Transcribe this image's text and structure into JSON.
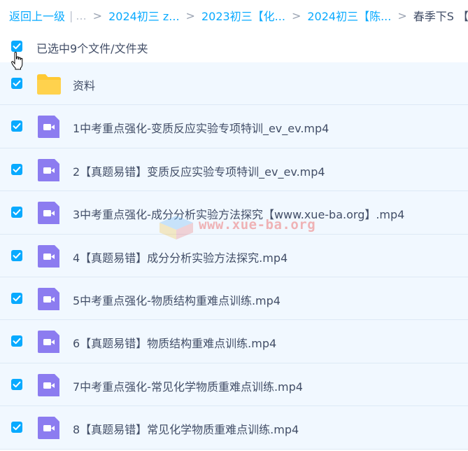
{
  "breadcrumb": {
    "back_label": "返回上一级",
    "separator_bar": "|",
    "ellipsis": "...",
    "arrow": ">",
    "items": [
      "2024初三 z...",
      "2023初三【化...",
      "2024初三【陈..."
    ],
    "current": "春季下S 【ww..."
  },
  "selection": {
    "summary": "已选中9个文件/文件夹",
    "all_checked": true
  },
  "files": [
    {
      "type": "folder",
      "name": "资料",
      "checked": true
    },
    {
      "type": "video",
      "name": "1中考重点强化-变质反应实验专项特训_ev_ev.mp4",
      "checked": true
    },
    {
      "type": "video",
      "name": "2【真题易错】变质反应实验专项特训_ev_ev.mp4",
      "checked": true
    },
    {
      "type": "video",
      "name": "3中考重点强化-成分分析实验方法探究【www.xue-ba.org】.mp4",
      "checked": true
    },
    {
      "type": "video",
      "name": "4【真题易错】成分分析实验方法探究.mp4",
      "checked": true
    },
    {
      "type": "video",
      "name": "5中考重点强化-物质结构重难点训练.mp4",
      "checked": true
    },
    {
      "type": "video",
      "name": "6【真题易错】物质结构重难点训练.mp4",
      "checked": true
    },
    {
      "type": "video",
      "name": "7中考重点强化-常见化学物质重难点训练.mp4",
      "checked": true
    },
    {
      "type": "video",
      "name": "8【真题易错】常见化学物质重难点训练.mp4",
      "checked": true
    }
  ],
  "watermark": {
    "text": "www.xue-ba.org"
  },
  "icons": {
    "checkbox": "checkbox-checked-icon",
    "folder": "folder-icon",
    "video": "video-file-icon",
    "cursor": "hand-pointer-icon"
  },
  "colors": {
    "accent": "#09aaff",
    "row_bg": "#f1f8ff",
    "row_border": "#dde9f5",
    "text": "#424e67",
    "folder": "#ffc933",
    "video_icon": "#8c7cf0"
  }
}
